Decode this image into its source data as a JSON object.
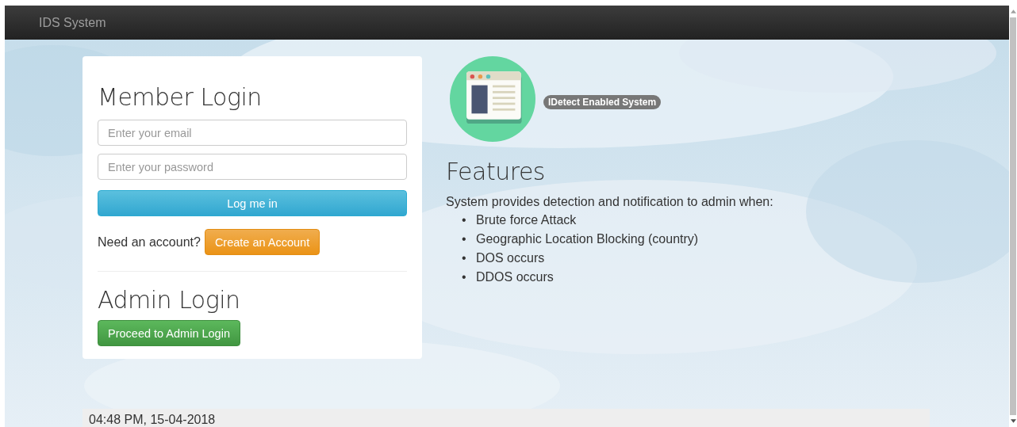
{
  "navbar": {
    "brand": "IDS System"
  },
  "member_login": {
    "title": "Member Login",
    "fields": [
      {
        "placeholder": "Enter your email"
      },
      {
        "placeholder": "Enter your password"
      }
    ],
    "login_button": "Log me in",
    "signup_prompt": "Need an account?",
    "signup_button": "Create an Account"
  },
  "admin_login": {
    "title": "Admin Login",
    "button": "Proceed to Admin Login"
  },
  "badge": "IDetect Enabled System",
  "features": {
    "title": "Features",
    "intro": "System provides detection and notification to admin when:",
    "items": [
      {
        "bullet": "•",
        "text": "Brute force Attack"
      },
      {
        "bullet": "•",
        "text": "Geographic Location Blocking (country)"
      },
      {
        "bullet": "•",
        "text": "DOS occurs"
      },
      {
        "bullet": "•",
        "text": "DDOS occurs"
      }
    ]
  },
  "footer": {
    "timestamp": "04:48 PM, 15-04-2018"
  }
}
